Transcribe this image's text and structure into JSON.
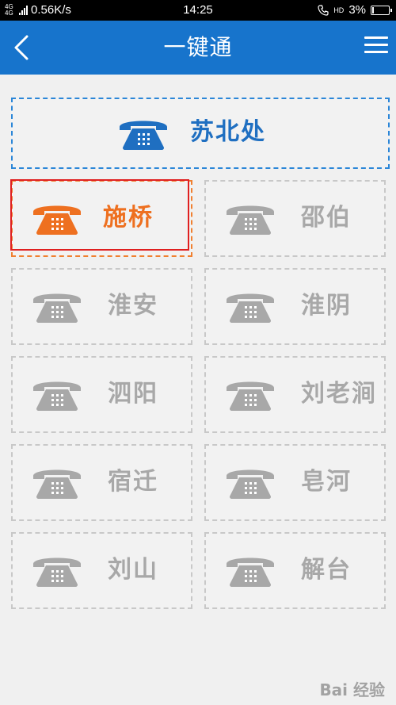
{
  "status_bar": {
    "network_type": "4G 4G",
    "speed": "0.56K/s",
    "time": "14:25",
    "hd_label": "HD",
    "battery": "3%"
  },
  "header": {
    "title": "一键通",
    "bg_color": "#1774cc"
  },
  "main_tile": {
    "label": "苏北处",
    "color": "#1f6fc1"
  },
  "tiles": [
    {
      "label": "施桥",
      "state": "active",
      "color": "#ee7020"
    },
    {
      "label": "邵伯",
      "state": "inactive"
    },
    {
      "label": "淮安",
      "state": "inactive"
    },
    {
      "label": "淮阴",
      "state": "inactive"
    },
    {
      "label": "泗阳",
      "state": "inactive"
    },
    {
      "label": "刘老涧",
      "state": "inactive"
    },
    {
      "label": "宿迁",
      "state": "inactive"
    },
    {
      "label": "皂河",
      "state": "inactive"
    },
    {
      "label": "刘山",
      "state": "inactive"
    },
    {
      "label": "解台",
      "state": "inactive"
    }
  ],
  "colors": {
    "inactive": "#a8a8a8",
    "accent": "#1774cc",
    "active": "#ee7020",
    "selection": "#e02020"
  },
  "icons": {
    "back": "chevron-left-icon",
    "menu": "hamburger-menu-icon",
    "tile": "telephone-icon"
  },
  "watermark": "Bai 经验"
}
